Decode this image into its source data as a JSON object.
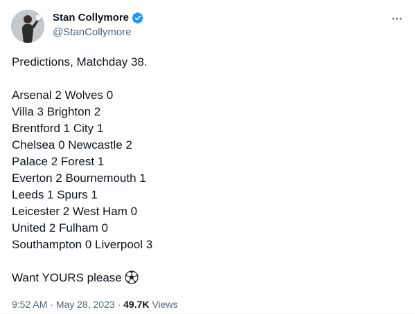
{
  "author": {
    "display_name": "Stan Collymore",
    "handle": "@StanCollymore",
    "verified": true
  },
  "tweet": {
    "intro": "Predictions, Matchday 38.",
    "predictions": [
      "Arsenal 2 Wolves 0",
      "Villa 3 Brighton 2",
      "Brentford 1 City 1",
      "Chelsea 0 Newcastle 2",
      "Palace 2 Forest 1",
      "Everton 2 Bournemouth 1",
      "Leeds 1 Spurs 1",
      "Leicester 2 West Ham 0",
      "United 2 Fulham 0",
      "Southampton 0 Liverpool 3"
    ],
    "closing": "Want YOURS please",
    "emoji": "soccer-ball-icon"
  },
  "meta": {
    "time": "9:52 AM",
    "separator": "·",
    "date": "May 28, 2023",
    "views_count": "49.7K",
    "views_label": "Views"
  },
  "icons": {
    "verified": "verified-badge-icon",
    "more": "more-options-icon"
  },
  "colors": {
    "text_primary": "#0f1419",
    "text_secondary": "#536471",
    "verified_blue": "#1d9bf0"
  }
}
